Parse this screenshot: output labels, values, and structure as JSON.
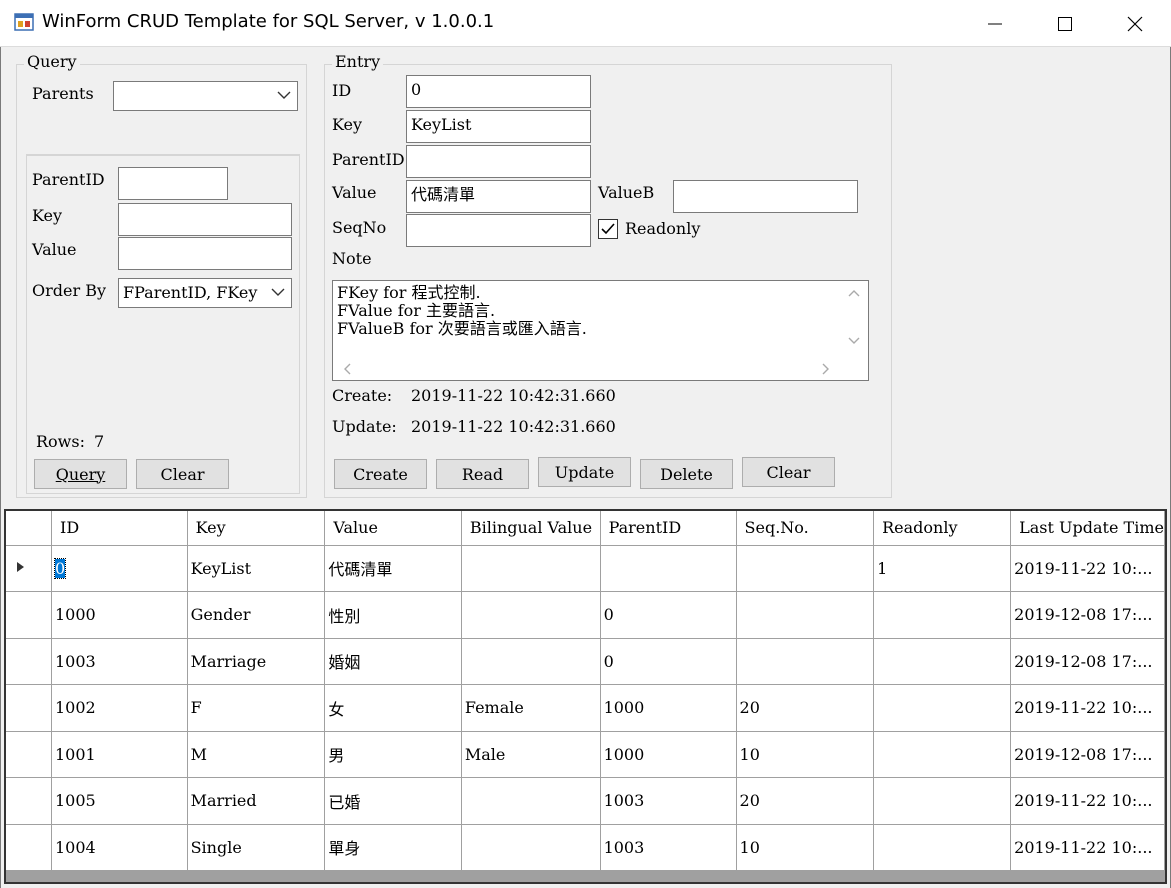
{
  "window": {
    "title": "WinForm CRUD Template for SQL Server, v 1.0.0.1"
  },
  "query": {
    "group_title": "Query",
    "parents_label": "Parents",
    "parents_value": "",
    "parentid_label": "ParentID",
    "parentid_value": "",
    "key_label": "Key",
    "key_value": "",
    "value_label": "Value",
    "value_value": "",
    "orderby_label": "Order By",
    "orderby_value": "FParentID, FKey",
    "rows_label": "Rows:",
    "rows_count": "7",
    "query_button": "Query",
    "clear_button": "Clear"
  },
  "entry": {
    "group_title": "Entry",
    "id_label": "ID",
    "id_value": "0",
    "key_label": "Key",
    "key_value": "KeyList",
    "parentid_label": "ParentID",
    "parentid_value": "",
    "value_label": "Value",
    "value_value": "代碼清單",
    "valueb_label": "ValueB",
    "valueb_value": "",
    "seqno_label": "SeqNo",
    "seqno_value": "",
    "readonly_label": "Readonly",
    "readonly_checked": true,
    "note_label": "Note",
    "note_lines": [
      "FKey for 程式控制.",
      "FValue for 主要語言.",
      "FValueB for 次要語言或匯入語言."
    ],
    "create_label": "Create:",
    "create_value": "2019-11-22 10:42:31.660",
    "update_label": "Update:",
    "update_value": "2019-11-22 10:42:31.660",
    "buttons": {
      "create": "Create",
      "read": "Read",
      "update": "Update",
      "delete": "Delete",
      "clear": "Clear"
    }
  },
  "grid": {
    "columns": [
      "ID",
      "Key",
      "Value",
      "Bilingual Value",
      "ParentID",
      "Seq.No.",
      "Readonly",
      "Last Update Time"
    ],
    "rows": [
      [
        "0",
        "KeyList",
        "代碼清單",
        "",
        "",
        "",
        "1",
        "2019-11-22 10:..."
      ],
      [
        "1000",
        "Gender",
        "性別",
        "",
        "0",
        "",
        "",
        "2019-12-08 17:..."
      ],
      [
        "1003",
        "Marriage",
        "婚姻",
        "",
        "0",
        "",
        "",
        "2019-12-08 17:..."
      ],
      [
        "1002",
        "F",
        "女",
        "Female",
        "1000",
        "20",
        "",
        "2019-11-22 10:..."
      ],
      [
        "1001",
        "M",
        "男",
        "Male",
        "1000",
        "10",
        "",
        "2019-12-08 17:..."
      ],
      [
        "1005",
        "Married",
        "已婚",
        "",
        "1003",
        "20",
        "",
        "2019-11-22 10:..."
      ],
      [
        "1004",
        "Single",
        "單身",
        "",
        "1003",
        "10",
        "",
        "2019-11-22 10:..."
      ]
    ]
  },
  "colors": {
    "selection": "#0078d7",
    "control_bg": "#f0f0f0",
    "button_bg": "#e1e1e1"
  }
}
